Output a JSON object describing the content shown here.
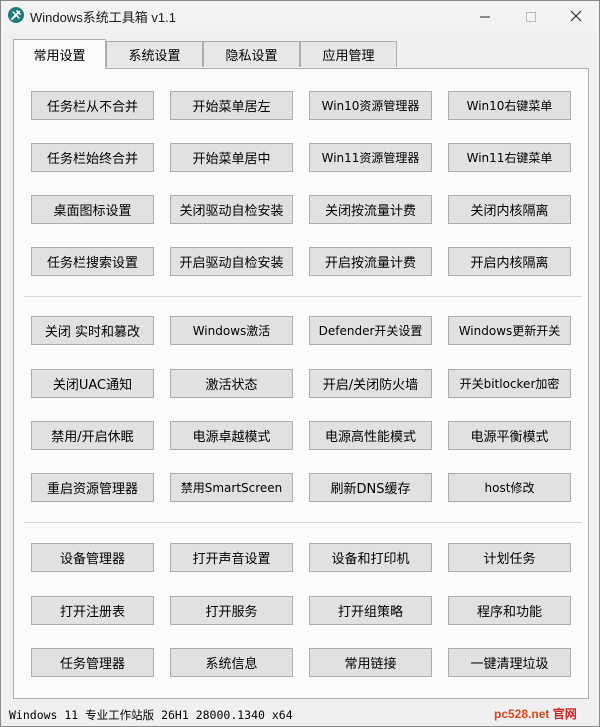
{
  "window": {
    "title": "Windows系统工具箱 v1.1",
    "controls": {
      "minimize": "minimize-icon",
      "maximize": "maximize-icon",
      "close": "close-icon"
    }
  },
  "tabs": [
    {
      "label": "常用设置",
      "active": true
    },
    {
      "label": "系统设置",
      "active": false
    },
    {
      "label": "隐私设置",
      "active": false
    },
    {
      "label": "应用管理",
      "active": false
    }
  ],
  "groups": [
    {
      "buttons": [
        [
          "任务栏从不合并",
          "开始菜单居左",
          "Win10资源管理器",
          "Win10右键菜单"
        ],
        [
          "任务栏始终合并",
          "开始菜单居中",
          "Win11资源管理器",
          "Win11右键菜单"
        ],
        [
          "桌面图标设置",
          "关闭驱动自检安装",
          "关闭按流量计费",
          "关闭内核隔离"
        ],
        [
          "任务栏搜索设置",
          "开启驱动自检安装",
          "开启按流量计费",
          "开启内核隔离"
        ]
      ]
    },
    {
      "buttons": [
        [
          "关闭 实时和篡改",
          "Windows激活",
          "Defender开关设置",
          "Windows更新开关"
        ],
        [
          "关闭UAC通知",
          "激活状态",
          "开启/关闭防火墙",
          "开关bitlocker加密"
        ],
        [
          "禁用/开启休眠",
          "电源卓越模式",
          "电源高性能模式",
          "电源平衡模式"
        ],
        [
          "重启资源管理器",
          "禁用SmartScreen",
          "刷新DNS缓存",
          "host修改"
        ]
      ]
    },
    {
      "buttons": [
        [
          "设备管理器",
          "打开声音设置",
          "设备和打印机",
          "计划任务"
        ],
        [
          "打开注册表",
          "打开服务",
          "打开组策略",
          "程序和功能"
        ],
        [
          "任务管理器",
          "系统信息",
          "常用链接",
          "一键清理垃圾"
        ]
      ]
    }
  ],
  "status": {
    "os_info": "Windows 11 专业工作站版 26H1 28000.1340 x64",
    "watermark_a": "pc528.net",
    "watermark_b": "官网"
  },
  "colors": {
    "accent": "#1e7b7b",
    "button_bg": "#e1e1e1",
    "button_border": "#adadad",
    "watermark_a": "#e0441a",
    "watermark_b": "#d6201e"
  }
}
